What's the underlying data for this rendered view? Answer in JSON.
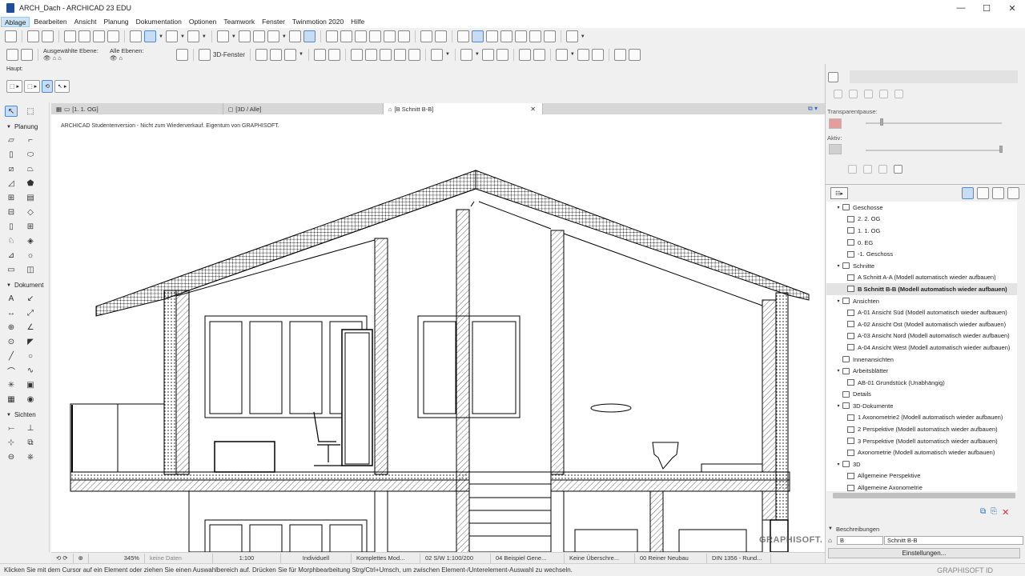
{
  "window": {
    "title": "ARCH_Dach - ARCHICAD 23 EDU",
    "controls": [
      "—",
      "☐",
      "✕"
    ]
  },
  "menu": [
    "Ablage",
    "Bearbeiten",
    "Ansicht",
    "Planung",
    "Dokumentation",
    "Optionen",
    "Teamwork",
    "Fenster",
    "Twinmotion 2020",
    "Hilfe"
  ],
  "toolbar2": {
    "selected_layers_label": "Ausgewählte Ebene:",
    "all_layers_label": "Alle Ebenen:",
    "window3d_label": "3D-Fenster"
  },
  "haupt": {
    "label": "Haupt:"
  },
  "toolbox": {
    "sections": [
      "Planung",
      "Dokument",
      "Sichten"
    ]
  },
  "tabs": [
    {
      "label": "[1. 1. OG]"
    },
    {
      "label": "[3D / Alle]"
    },
    {
      "label": "[B Schnitt B-B]"
    }
  ],
  "canvas": {
    "note": "ARCHICAD Studentenversion - Nicht zum Wiederverkauf. Eigentum von GRAPHISOFT.",
    "watermark": "GRAPHISOFT."
  },
  "quickbar": {
    "zoom": "345%",
    "keine_daten": "keine Daten",
    "scale": "1:100",
    "individuell": "Individuell",
    "modell": "Komplettes Mod...",
    "stift": "02 S/W 1:100/200",
    "beispiel": "04 Beispiel Gene...",
    "ueberschr": "Keine Überschre...",
    "neubau": "00 Reiner Neubau",
    "din": "DIN 1356 - Rund..."
  },
  "status": {
    "text": "Klicken Sie mit dem Cursor auf ein Element oder ziehen Sie einen Auswahlbereich auf. Drücken Sie für Morphbearbeitung Strg/Ctrl+Umsch, um zwischen Element-/Unterelement-Auswahl zu wechseln.",
    "graphisoft_id": "GRAPHISOFT ID"
  },
  "rightpanel": {
    "transparentpause": "Transparentpause:",
    "aktiv": "Aktiv:"
  },
  "navigator": {
    "rows": [
      {
        "label": "Geschosse",
        "level": 1,
        "tri": "v"
      },
      {
        "label": "2. 2. OG",
        "level": 2
      },
      {
        "label": "1. 1. OG",
        "level": 2
      },
      {
        "label": "0. EG",
        "level": 2
      },
      {
        "label": "-1. Geschoss",
        "level": 2
      },
      {
        "label": "Schnitte",
        "level": 1,
        "tri": "v"
      },
      {
        "label": "A Schnitt A-A (Modell automatisch wieder aufbauen)",
        "level": 2
      },
      {
        "label": "B Schnitt B-B (Modell automatisch wieder aufbauen)",
        "level": 2,
        "selected": true
      },
      {
        "label": "Ansichten",
        "level": 1,
        "tri": "v"
      },
      {
        "label": "A-01 Ansicht Süd (Modell automatisch wieder aufbauen)",
        "level": 2
      },
      {
        "label": "A-02 Ansicht Ost (Modell automatisch wieder aufbauen)",
        "level": 2
      },
      {
        "label": "A-03 Ansicht Nord (Modell automatisch wieder aufbauen)",
        "level": 2
      },
      {
        "label": "A-04 Ansicht West (Modell automatisch wieder aufbauen)",
        "level": 2
      },
      {
        "label": "Innenansichten",
        "level": 1
      },
      {
        "label": "Arbeitsblätter",
        "level": 1,
        "tri": "v"
      },
      {
        "label": "AB-01 Grundstück (Unabhängig)",
        "level": 2
      },
      {
        "label": "Details",
        "level": 1
      },
      {
        "label": "3D-Dokumente",
        "level": 1,
        "tri": "v"
      },
      {
        "label": "1 Axonometrie2 (Modell automatisch wieder aufbauen)",
        "level": 2
      },
      {
        "label": "2 Perspektive (Modell automatisch wieder aufbauen)",
        "level": 2
      },
      {
        "label": "3 Perspektive (Modell automatisch wieder aufbauen)",
        "level": 2
      },
      {
        "label": "Axonometrie (Modell automatisch wieder aufbauen)",
        "level": 2
      },
      {
        "label": "3D",
        "level": 1,
        "tri": "v"
      },
      {
        "label": "Allgemeine Perspektive",
        "level": 2
      },
      {
        "label": "Allgemeine Axonometrie",
        "level": 2
      }
    ]
  },
  "beschreibungen": {
    "header": "Beschreibungen",
    "id_value": "B",
    "name_value": "Schnitt B-B",
    "settings_button": "Einstellungen..."
  }
}
